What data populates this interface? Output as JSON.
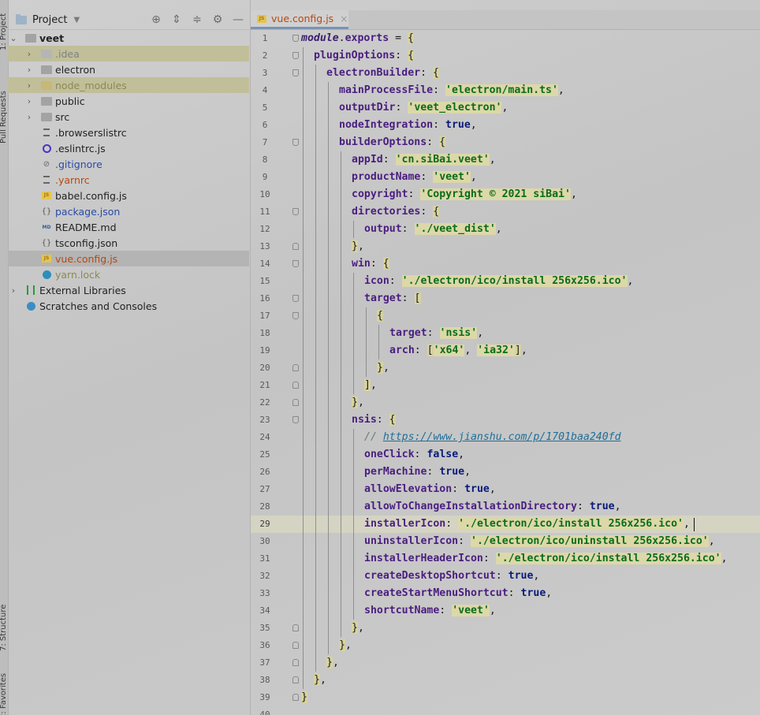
{
  "tool_strip": {
    "tabs": [
      {
        "label": "1: Project"
      },
      {
        "label": "Pull Requests"
      },
      {
        "label": "7: Structure"
      },
      {
        "label": "2: Favorites"
      }
    ]
  },
  "project_panel": {
    "title": "Project",
    "root": {
      "label": "veet"
    },
    "items": [
      {
        "label": ".idea"
      },
      {
        "label": "electron"
      },
      {
        "label": "node_modules"
      },
      {
        "label": "public"
      },
      {
        "label": "src"
      },
      {
        "label": ".browserslistrc"
      },
      {
        "label": ".eslintrc.js"
      },
      {
        "label": ".gitignore"
      },
      {
        "label": ".yarnrc"
      },
      {
        "label": "babel.config.js"
      },
      {
        "label": "package.json"
      },
      {
        "label": "README.md"
      },
      {
        "label": "tsconfig.json"
      },
      {
        "label": "vue.config.js"
      },
      {
        "label": "yarn.lock"
      }
    ],
    "external_libraries": "External Libraries",
    "scratches": "Scratches and Consoles"
  },
  "editor": {
    "tab_label": "vue.config.js",
    "current_line": 29,
    "lines": [
      {
        "no": "1",
        "text": "module.exports = {"
      },
      {
        "no": "2",
        "text": "pluginOptions: {"
      },
      {
        "no": "3",
        "text": "electronBuilder: {"
      },
      {
        "no": "4",
        "text": "mainProcessFile: 'electron/main.ts',"
      },
      {
        "no": "5",
        "text": "outputDir: 'veet_electron',"
      },
      {
        "no": "6",
        "text": "nodeIntegration: true,"
      },
      {
        "no": "7",
        "text": "builderOptions: {"
      },
      {
        "no": "8",
        "text": "appId: 'cn.siBai.veet',"
      },
      {
        "no": "9",
        "text": "productName: 'veet',"
      },
      {
        "no": "10",
        "text": "copyright: 'Copyright © 2021 siBai',"
      },
      {
        "no": "11",
        "text": "directories: {"
      },
      {
        "no": "12",
        "text": "output: './veet_dist',"
      },
      {
        "no": "13",
        "text": "},"
      },
      {
        "no": "14",
        "text": "win: {"
      },
      {
        "no": "15",
        "text": "icon: './electron/ico/install 256x256.ico',"
      },
      {
        "no": "16",
        "text": "target: ["
      },
      {
        "no": "17",
        "text": "{"
      },
      {
        "no": "18",
        "text": "target: 'nsis',"
      },
      {
        "no": "19",
        "text": "arch: ['x64', 'ia32'],"
      },
      {
        "no": "20",
        "text": "},"
      },
      {
        "no": "21",
        "text": "],"
      },
      {
        "no": "22",
        "text": "},"
      },
      {
        "no": "23",
        "text": "nsis: {"
      },
      {
        "no": "24",
        "text": "// https://www.jianshu.com/p/1701baa240fd"
      },
      {
        "no": "25",
        "text": "oneClick: false,"
      },
      {
        "no": "26",
        "text": "perMachine: true,"
      },
      {
        "no": "27",
        "text": "allowElevation: true,"
      },
      {
        "no": "28",
        "text": "allowToChangeInstallationDirectory: true,"
      },
      {
        "no": "29",
        "text": "installerIcon: './electron/ico/install 256x256.ico',"
      },
      {
        "no": "30",
        "text": "uninstallerIcon: './electron/ico/uninstall 256x256.ico',"
      },
      {
        "no": "31",
        "text": "installerHeaderIcon: './electron/ico/install 256x256.ico',"
      },
      {
        "no": "32",
        "text": "createDesktopShortcut: true,"
      },
      {
        "no": "33",
        "text": "createStartMenuShortcut: true,"
      },
      {
        "no": "34",
        "text": "shortcutName: 'veet',"
      },
      {
        "no": "35",
        "text": "},"
      },
      {
        "no": "36",
        "text": "},"
      },
      {
        "no": "37",
        "text": "},"
      },
      {
        "no": "38",
        "text": "},"
      },
      {
        "no": "39",
        "text": "}"
      },
      {
        "no": "40",
        "text": ""
      }
    ]
  }
}
